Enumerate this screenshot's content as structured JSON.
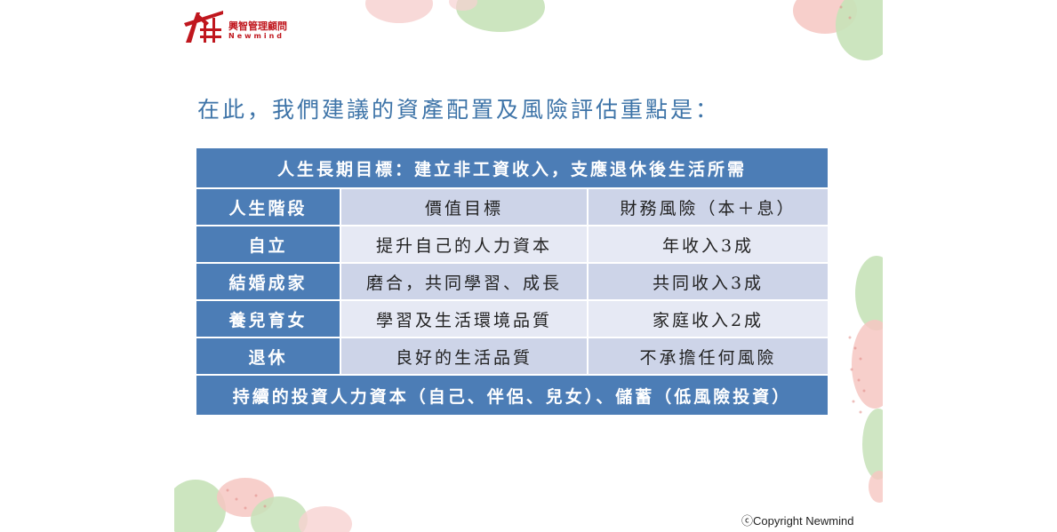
{
  "logo": {
    "name_cn": "興智管理顧問",
    "name_en": "Newmind",
    "brand_color": "#c0171e"
  },
  "heading": "在此，我們建議的資產配置及風險評估重點是：",
  "table": {
    "banner": "人生長期目標：建立非工資收入，支應退休後生活所需",
    "headers": [
      "人生階段",
      "價值目標",
      "財務風險（本＋息）"
    ],
    "rows": [
      {
        "stage": "自立",
        "goal": "提升自己的人力資本",
        "risk": "年收入3成"
      },
      {
        "stage": "結婚成家",
        "goal": "磨合，共同學習、成長",
        "risk": "共同收入3成"
      },
      {
        "stage": "養兒育女",
        "goal": "學習及生活環境品質",
        "risk": "家庭收入2成"
      },
      {
        "stage": "退休",
        "goal": "良好的生活品質",
        "risk": "不承擔任何風險"
      }
    ],
    "footer": "持續的投資人力資本（自己、伴侶、兒女）、儲蓄（低風險投資）",
    "colors": {
      "blue": "#4c7db6",
      "dark": "#cdd4e8",
      "light": "#e6e9f4"
    }
  },
  "copyright": "ⓒCopyright Newmind"
}
